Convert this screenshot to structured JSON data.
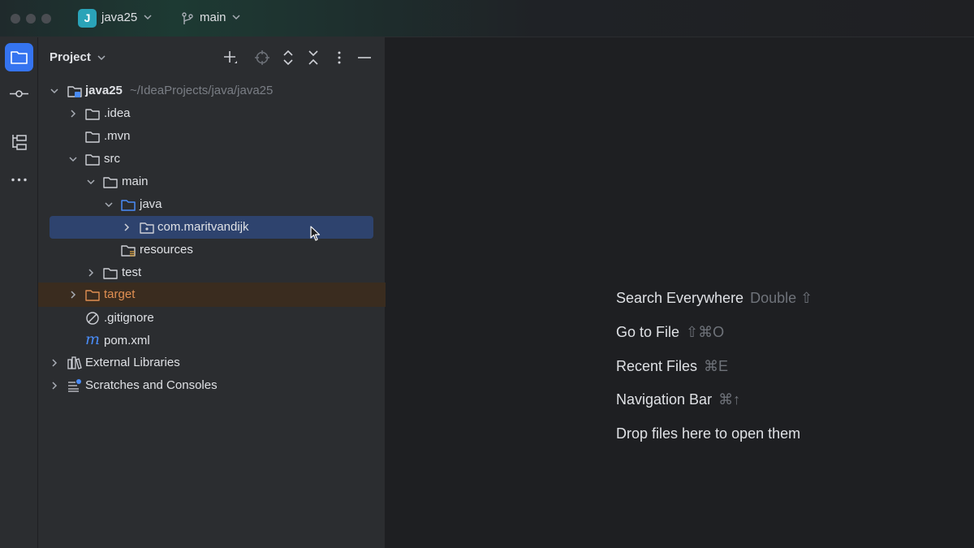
{
  "titlebar": {
    "project_badge": "J",
    "project_name": "java25",
    "branch_name": "main",
    "icons": [
      "chevron-down-icon",
      "git-branch-icon"
    ]
  },
  "toolstrip": {
    "tools": [
      "project-tool-icon",
      "commit-tool-icon",
      "structure-tool-icon",
      "more-tools-icon"
    ]
  },
  "panel": {
    "title": "Project",
    "actions": [
      "add-icon",
      "locate-icon",
      "expand-all-icon",
      "collapse-all-icon",
      "kebab-menu-icon",
      "minimize-icon"
    ]
  },
  "tree": {
    "root_label": "java25",
    "root_path": "~/IdeaProjects/java/java25",
    "items": [
      {
        "label": ".idea"
      },
      {
        "label": ".mvn"
      },
      {
        "label": "src"
      },
      {
        "label": "main"
      },
      {
        "label": "java"
      },
      {
        "label": "com.maritvandijk"
      },
      {
        "label": "resources"
      },
      {
        "label": "test"
      },
      {
        "label": "target"
      },
      {
        "label": ".gitignore"
      },
      {
        "label": "pom.xml"
      },
      {
        "label": "External Libraries"
      },
      {
        "label": "Scratches and Consoles"
      }
    ]
  },
  "editor_hints": [
    {
      "label": "Search Everywhere",
      "shortcut": "Double ⇧"
    },
    {
      "label": "Go to File",
      "shortcut": "⇧⌘O"
    },
    {
      "label": "Recent Files",
      "shortcut": "⌘E"
    },
    {
      "label": "Navigation Bar",
      "shortcut": "⌘↑"
    },
    {
      "label": "Drop files here to open them",
      "shortcut": ""
    }
  ],
  "colors": {
    "accent": "#3574f0",
    "selection": "#2e436e",
    "excluded_text": "#e08f52",
    "package_folder": "#4a8cf7"
  }
}
